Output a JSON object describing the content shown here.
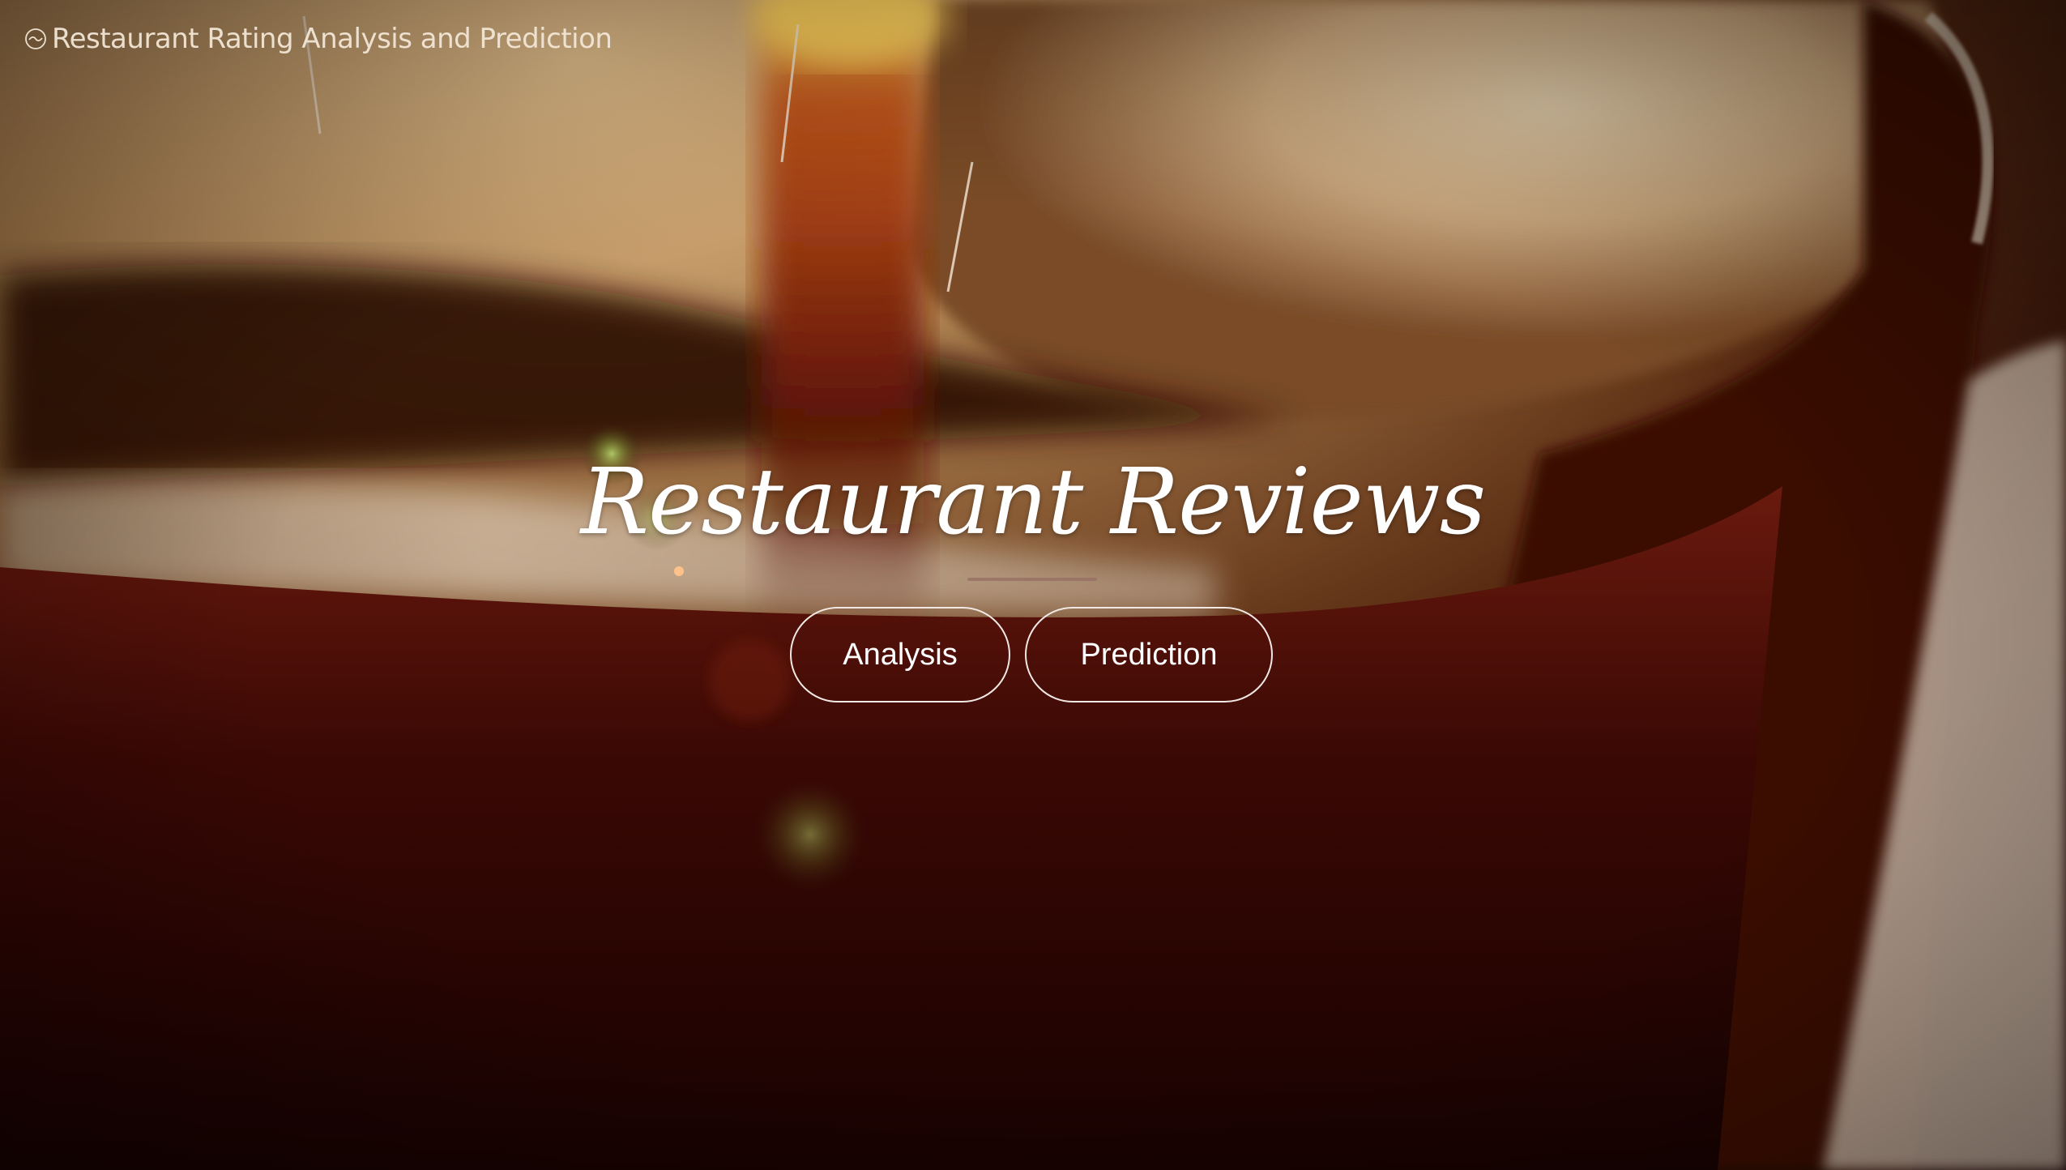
{
  "header": {
    "brand_title": "Restaurant Rating Analysis and Prediction",
    "logo_icon": "circle-wave-icon"
  },
  "hero": {
    "title": "Restaurant Reviews",
    "buttons": [
      {
        "label": "Analysis"
      },
      {
        "label": "Prediction"
      }
    ],
    "background": "coffee-pouring-into-mug-photo"
  },
  "colors": {
    "text": "#ffffff",
    "background_dark": "#1a0402",
    "mug_red": "#5a0e08",
    "foam_cream": "#d8b890"
  }
}
